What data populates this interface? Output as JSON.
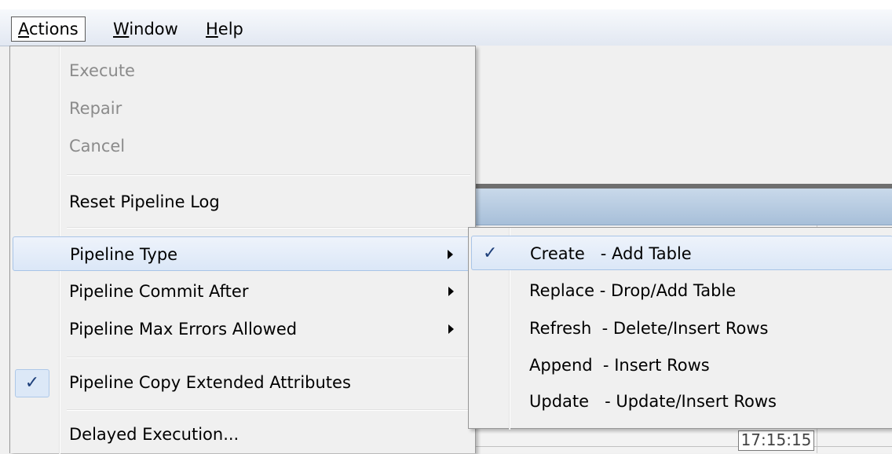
{
  "menubar": {
    "items": [
      {
        "label": "Actions",
        "accel": "A",
        "rest": "ctions",
        "active": true
      },
      {
        "label": "Window",
        "accel": "W",
        "rest": "indow",
        "active": false
      },
      {
        "label": "Help",
        "accel": "H",
        "rest": "elp",
        "active": false
      }
    ]
  },
  "actions_menu": {
    "execute": "Execute",
    "repair": "Repair",
    "cancel": "Cancel",
    "reset_log": "Reset Pipeline Log",
    "pipeline_type": "Pipeline Type",
    "commit_after": "Pipeline Commit After",
    "max_errors": "Pipeline Max Errors Allowed",
    "copy_ext_attrs": "Pipeline Copy Extended Attributes",
    "copy_ext_attrs_checked": true,
    "delayed_exec": "Delayed Execution..."
  },
  "pipeline_type_submenu": {
    "items": [
      {
        "label": "Create   - Add Table",
        "checked": true
      },
      {
        "label": "Replace - Drop/Add Table",
        "checked": false
      },
      {
        "label": "Refresh  - Delete/Insert Rows",
        "checked": false
      },
      {
        "label": "Append  - Insert Rows",
        "checked": false
      },
      {
        "label": "Update   - Update/Insert Rows",
        "checked": false
      }
    ]
  },
  "background": {
    "partial_cell_text": "17:15:15"
  },
  "icons": {
    "check": "✓",
    "submenu_arrow": "chevron-right-icon"
  }
}
